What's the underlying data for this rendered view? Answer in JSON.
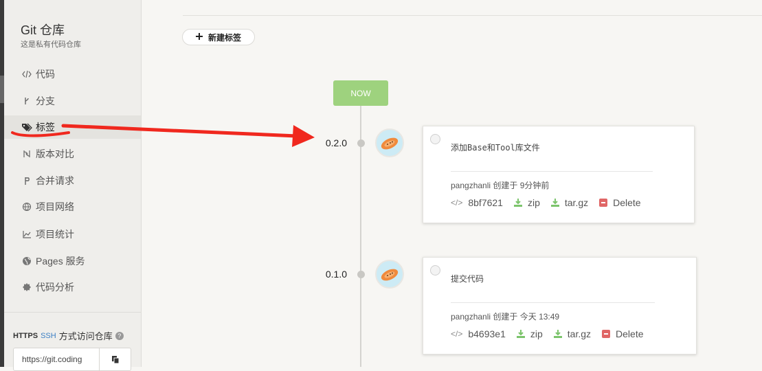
{
  "sidebar": {
    "title": "Git 仓库",
    "subtitle": "这是私有代码仓库",
    "items": [
      {
        "label": "代码",
        "icon": "code-icon"
      },
      {
        "label": "分支",
        "icon": "branch-icon"
      },
      {
        "label": "标签",
        "icon": "tag-icon"
      },
      {
        "label": "版本对比",
        "icon": "compare-icon"
      },
      {
        "label": "合并请求",
        "icon": "merge-request-icon"
      },
      {
        "label": "项目网络",
        "icon": "network-icon"
      },
      {
        "label": "项目统计",
        "icon": "stats-icon"
      },
      {
        "label": "Pages 服务",
        "icon": "globe-icon"
      },
      {
        "label": "代码分析",
        "icon": "analysis-icon"
      }
    ],
    "active_item": "标签",
    "access": {
      "https": "HTTPS",
      "ssh": "SSH",
      "text": "方式访问仓库",
      "help": "?",
      "url": "https://git.coding"
    }
  },
  "main": {
    "new_tag_label": "新建标签",
    "now_label": "NOW",
    "tags": [
      {
        "version": "0.2.0",
        "message": "添加Base和Tool库文件",
        "author": "pangzhanli",
        "created": "创建于 9分钟前",
        "commit": "8bf7621",
        "zip": "zip",
        "targz": "tar.gz",
        "delete": "Delete"
      },
      {
        "version": "0.1.0",
        "message": "提交代码",
        "author": "pangzhanli",
        "created": "创建于 今天 13:49",
        "commit": "b4693e1",
        "zip": "zip",
        "targz": "tar.gz",
        "delete": "Delete"
      }
    ]
  },
  "colors": {
    "now_green": "#9ed27e",
    "annotation_red": "#f0281e",
    "ssh_blue": "#3b7fc4",
    "delete_red": "#e06666",
    "download_green": "#7cc46c"
  }
}
